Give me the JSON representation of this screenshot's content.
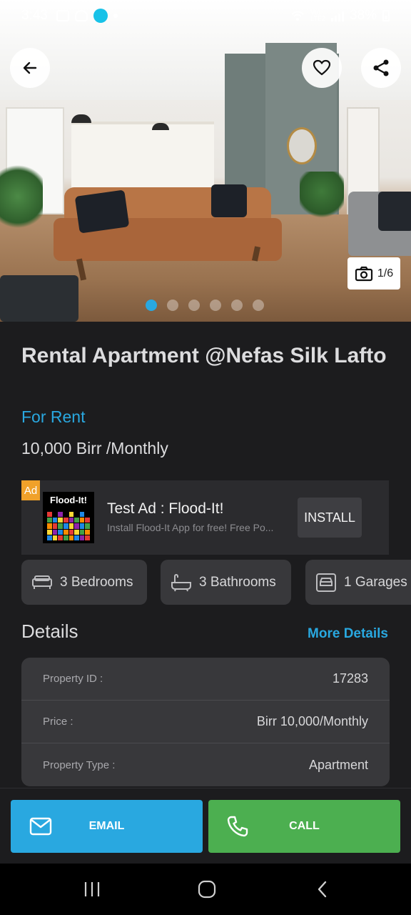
{
  "status_bar": {
    "time": "3:43",
    "battery": "38%",
    "icons": [
      "gallery-icon",
      "bird-icon",
      "app-s-icon",
      "dot",
      "alarm-off-icon",
      "mute-icon",
      "wifi-icon",
      "volte-icon",
      "signal-icon",
      "battery-icon"
    ]
  },
  "gallery": {
    "counter": "1/6",
    "total_images": 6,
    "active_index": 0
  },
  "listing": {
    "title": "Rental Apartment @Nefas Silk Lafto",
    "status": "For Rent",
    "price": "10,000 Birr /Monthly"
  },
  "ad": {
    "badge": "Ad",
    "logo_text": "Flood-It!",
    "title": "Test Ad : Flood-It!",
    "description": "Install Flood-It App for free! Free Po...",
    "install_label": "INSTALL"
  },
  "features": [
    {
      "icon": "bed-icon",
      "label": "3  Bedrooms"
    },
    {
      "icon": "bathtub-icon",
      "label": "3  Bathrooms"
    },
    {
      "icon": "garage-icon",
      "label": "1  Garages"
    }
  ],
  "details": {
    "heading": "Details",
    "more_label": "More Details",
    "rows": [
      {
        "key": "Property ID :",
        "value": "17283"
      },
      {
        "key": "Price :",
        "value": "Birr 10,000/Monthly"
      },
      {
        "key": "Property Type :",
        "value": "Apartment"
      }
    ]
  },
  "actions": {
    "email_label": "EMAIL",
    "call_label": "CALL"
  },
  "colors": {
    "accent": "#29a8e0",
    "call": "#4caf50",
    "background": "#1c1c1e",
    "card": "#38383b",
    "ad_badge": "#f0a12a"
  }
}
